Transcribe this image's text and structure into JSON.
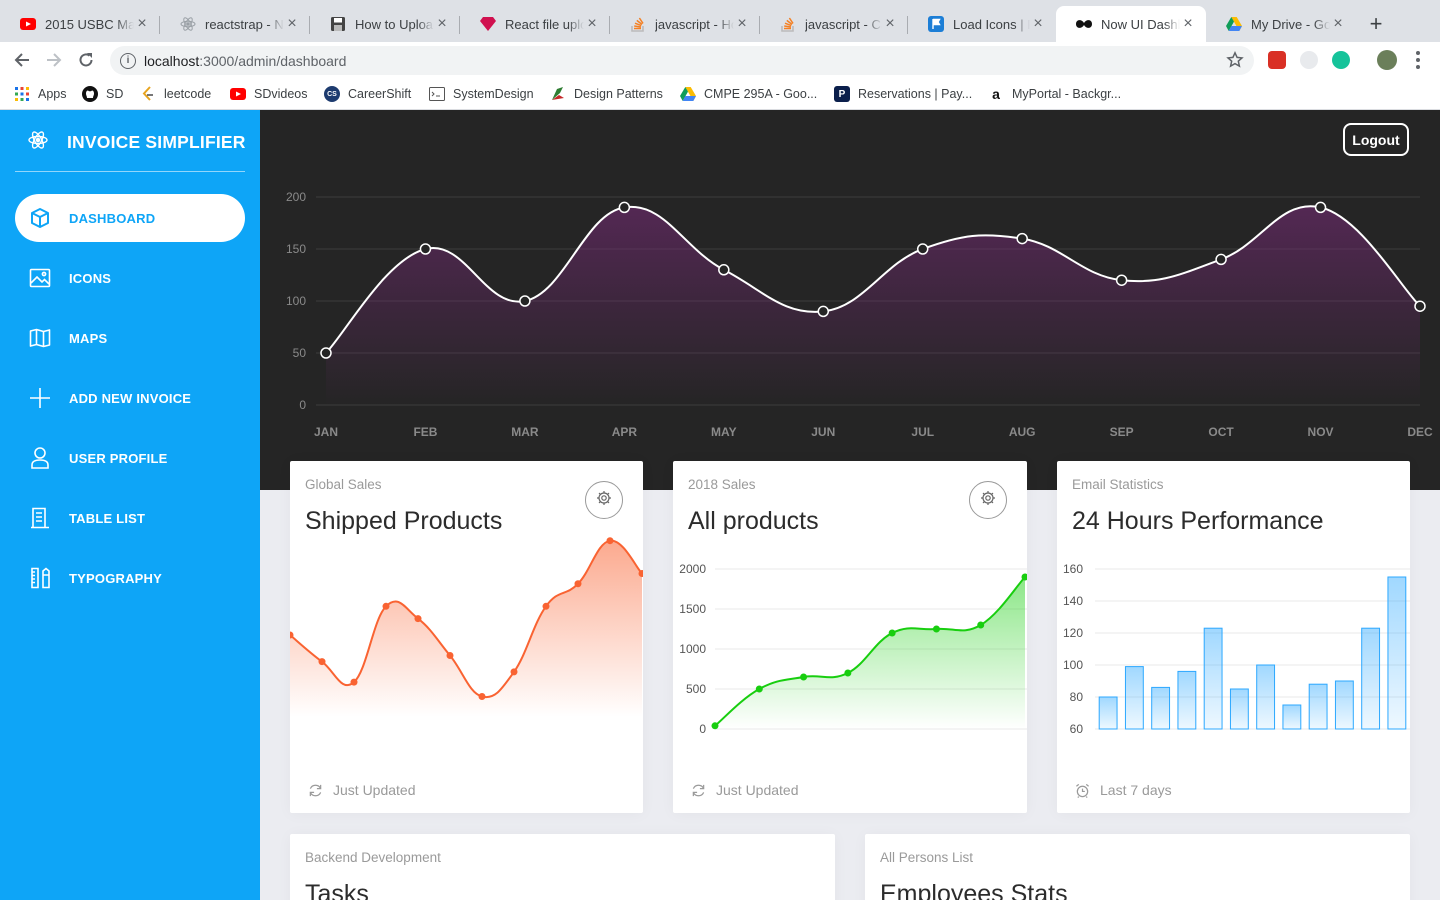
{
  "browser": {
    "tabs": [
      {
        "title": "2015 USBC Ma",
        "icon": "youtube-icon"
      },
      {
        "title": "reactstrap - Na",
        "icon": "react-icon"
      },
      {
        "title": "How to Upload",
        "icon": "floppy-disk-icon"
      },
      {
        "title": "React file uploa",
        "icon": "ruby-gem-icon"
      },
      {
        "title": "javascript - Ho",
        "icon": "stackoverflow-icon"
      },
      {
        "title": "javascript - Ca",
        "icon": "stackoverflow-icon"
      },
      {
        "title": "Load Icons | Fo",
        "icon": "flag-icon"
      },
      {
        "title": "Now UI Dashbo",
        "icon": "now-ui-icon"
      },
      {
        "title": "My Drive - Goo",
        "icon": "google-drive-icon"
      }
    ],
    "url_host": "localhost",
    "url_path": ":3000/admin/dashboard",
    "bookmarks": [
      {
        "label": "Apps",
        "icon": "apps-grid-icon"
      },
      {
        "label": "SD",
        "icon": "github-icon"
      },
      {
        "label": "leetcode",
        "icon": "leetcode-icon"
      },
      {
        "label": "SDvideos",
        "icon": "youtube-icon"
      },
      {
        "label": "CareerShift",
        "icon": "careershift-icon"
      },
      {
        "label": "SystemDesign",
        "icon": "system-design-icon"
      },
      {
        "label": "Design Patterns",
        "icon": "design-patterns-icon"
      },
      {
        "label": "CMPE 295A - Goo...",
        "icon": "google-drive-icon"
      },
      {
        "label": "Reservations | Pay...",
        "icon": "parking-icon"
      },
      {
        "label": "MyPortal - Backgr...",
        "icon": "amazon-icon"
      }
    ]
  },
  "sidebar": {
    "brand": "INVOICE SIMPLIFIER",
    "items": [
      {
        "label": "DASHBOARD",
        "icon": "cube-icon",
        "active": true
      },
      {
        "label": "ICONS",
        "icon": "image-icon"
      },
      {
        "label": "MAPS",
        "icon": "map-icon"
      },
      {
        "label": "ADD NEW INVOICE",
        "icon": "plus-icon"
      },
      {
        "label": "USER PROFILE",
        "icon": "user-icon"
      },
      {
        "label": "TABLE LIST",
        "icon": "list-icon"
      },
      {
        "label": "TYPOGRAPHY",
        "icon": "ruler-pencil-icon"
      }
    ]
  },
  "header": {
    "logout_label": "Logout"
  },
  "cards": [
    {
      "category": "Global Sales",
      "title": "Shipped Products",
      "footer": "Just Updated",
      "footer_icon": "refresh-icon"
    },
    {
      "category": "2018 Sales",
      "title": "All products",
      "footer": "Just Updated",
      "footer_icon": "refresh-icon"
    },
    {
      "category": "Email Statistics",
      "title": "24 Hours Performance",
      "footer": "Last 7 days",
      "footer_icon": "alarm-icon"
    },
    {
      "category": "Backend Development",
      "title": "Tasks"
    },
    {
      "category": "All Persons List",
      "title": "Employees Stats"
    }
  ],
  "colors": {
    "sidebar": "#0ea5f7",
    "header_bg": "#252525",
    "orange": "#f96332",
    "green": "#18ce0f",
    "blue": "#2ca8ff"
  },
  "chart_data": [
    {
      "type": "line",
      "categories": [
        "JAN",
        "FEB",
        "MAR",
        "APR",
        "MAY",
        "JUN",
        "JUL",
        "AUG",
        "SEP",
        "OCT",
        "NOV",
        "DEC"
      ],
      "values": [
        50,
        150,
        100,
        190,
        130,
        90,
        150,
        160,
        120,
        140,
        190,
        95
      ],
      "ylim": [
        0,
        200
      ],
      "yticks": [
        0,
        50,
        100,
        150,
        200
      ],
      "grid": true
    },
    {
      "type": "line",
      "values": [
        40,
        27,
        17,
        54,
        48,
        30,
        10,
        22,
        54,
        65,
        86,
        70
      ],
      "axes_visible": false
    },
    {
      "type": "line",
      "values": [
        40,
        500,
        650,
        700,
        1200,
        1250,
        1300,
        1900
      ],
      "ylim": [
        0,
        2000
      ],
      "yticks": [
        0,
        500,
        1000,
        1500,
        2000
      ],
      "grid": true
    },
    {
      "type": "bar",
      "values": [
        80,
        99,
        86,
        96,
        123,
        85,
        100,
        75,
        88,
        90,
        123,
        155
      ],
      "ylim": [
        60,
        160
      ],
      "yticks": [
        60,
        80,
        100,
        120,
        140,
        160
      ],
      "grid": true
    }
  ]
}
